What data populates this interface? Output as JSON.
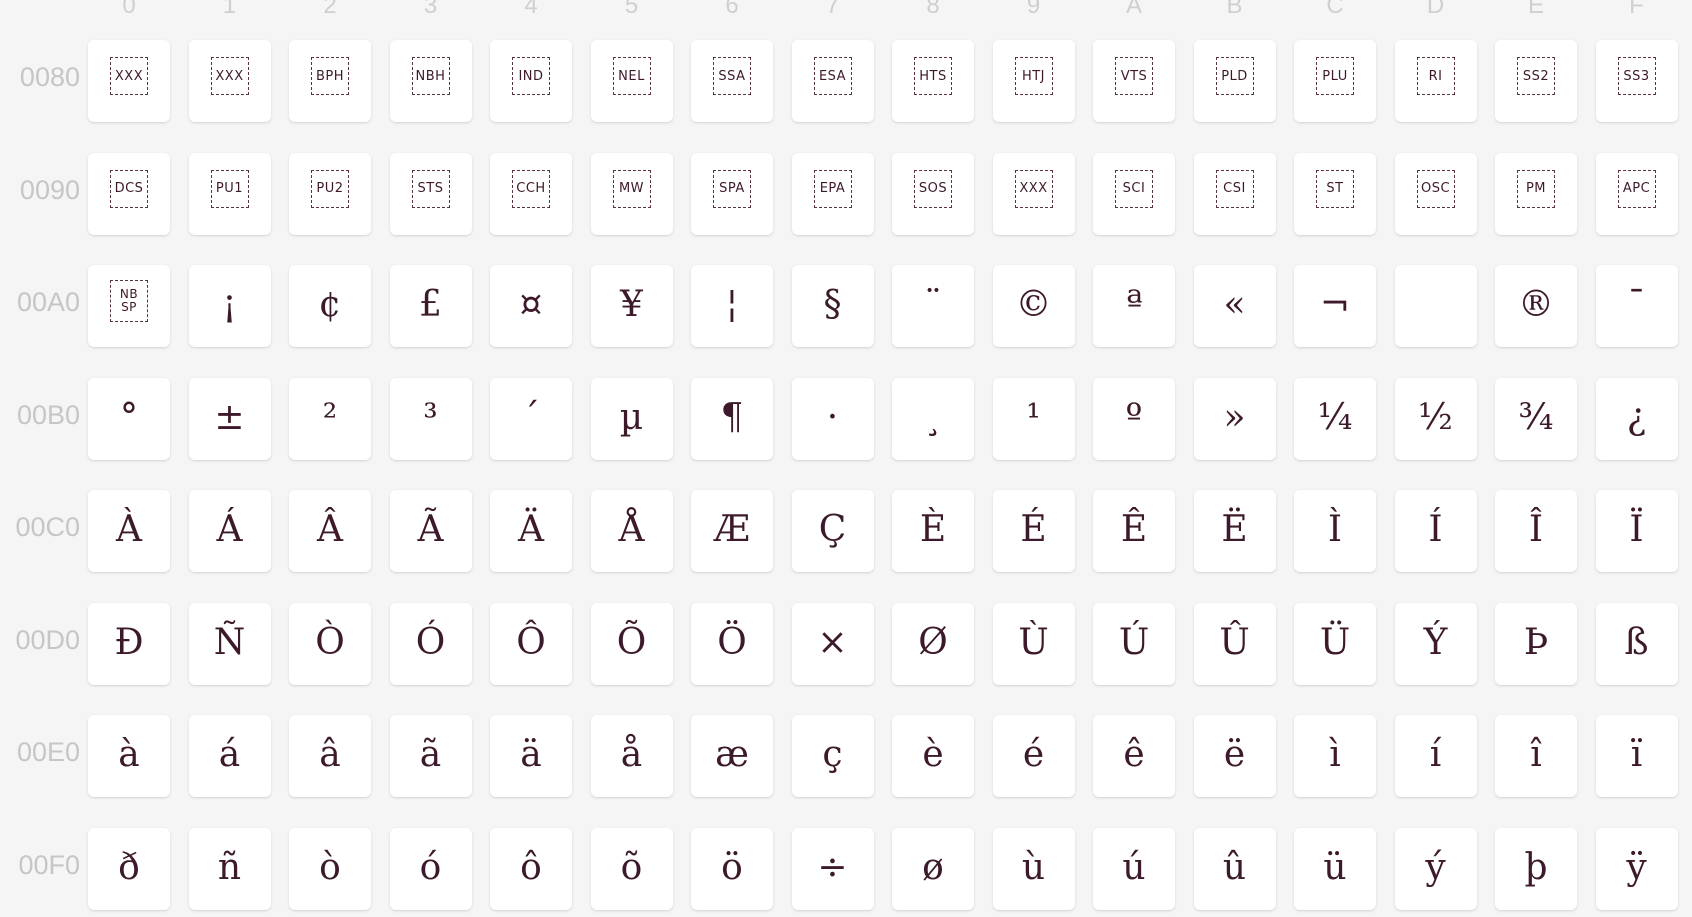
{
  "columns": [
    "0",
    "1",
    "2",
    "3",
    "4",
    "5",
    "6",
    "7",
    "8",
    "9",
    "A",
    "B",
    "C",
    "D",
    "E",
    "F"
  ],
  "rows": [
    {
      "label": "0080",
      "cells": [
        {
          "glyph": "XXX",
          "control": true,
          "name": "XXX"
        },
        {
          "glyph": "XXX",
          "control": true,
          "name": "XXX"
        },
        {
          "glyph": "BPH",
          "control": true,
          "name": "BPH"
        },
        {
          "glyph": "NBH",
          "control": true,
          "name": "NBH"
        },
        {
          "glyph": "IND",
          "control": true,
          "name": "IND"
        },
        {
          "glyph": "NEL",
          "control": true,
          "name": "NEL"
        },
        {
          "glyph": "SSA",
          "control": true,
          "name": "SSA"
        },
        {
          "glyph": "ESA",
          "control": true,
          "name": "ESA"
        },
        {
          "glyph": "HTS",
          "control": true,
          "name": "HTS"
        },
        {
          "glyph": "HTJ",
          "control": true,
          "name": "HTJ"
        },
        {
          "glyph": "VTS",
          "control": true,
          "name": "VTS"
        },
        {
          "glyph": "PLD",
          "control": true,
          "name": "PLD"
        },
        {
          "glyph": "PLU",
          "control": true,
          "name": "PLU"
        },
        {
          "glyph": "RI",
          "control": true,
          "name": "RI"
        },
        {
          "glyph": "SS2",
          "control": true,
          "name": "SS2"
        },
        {
          "glyph": "SS3",
          "control": true,
          "name": "SS3"
        }
      ]
    },
    {
      "label": "0090",
      "cells": [
        {
          "glyph": "DCS",
          "control": true,
          "name": "DCS"
        },
        {
          "glyph": "PU1",
          "control": true,
          "name": "PU1"
        },
        {
          "glyph": "PU2",
          "control": true,
          "name": "PU2"
        },
        {
          "glyph": "STS",
          "control": true,
          "name": "STS"
        },
        {
          "glyph": "CCH",
          "control": true,
          "name": "CCH"
        },
        {
          "glyph": "MW",
          "control": true,
          "name": "MW"
        },
        {
          "glyph": "SPA",
          "control": true,
          "name": "SPA"
        },
        {
          "glyph": "EPA",
          "control": true,
          "name": "EPA"
        },
        {
          "glyph": "SOS",
          "control": true,
          "name": "SOS"
        },
        {
          "glyph": "XXX",
          "control": true,
          "name": "XXX"
        },
        {
          "glyph": "SCI",
          "control": true,
          "name": "SCI"
        },
        {
          "glyph": "CSI",
          "control": true,
          "name": "CSI"
        },
        {
          "glyph": "ST",
          "control": true,
          "name": "ST"
        },
        {
          "glyph": "OSC",
          "control": true,
          "name": "OSC"
        },
        {
          "glyph": "PM",
          "control": true,
          "name": "PM"
        },
        {
          "glyph": "APC",
          "control": true,
          "name": "APC"
        }
      ]
    },
    {
      "label": "00A0",
      "cells": [
        {
          "glyph": "NB SP",
          "control": true,
          "two_line": true,
          "name": "NBSP"
        },
        {
          "glyph": "¡",
          "name": "inverted-exclamation"
        },
        {
          "glyph": "¢",
          "name": "cent"
        },
        {
          "glyph": "£",
          "name": "pound"
        },
        {
          "glyph": "¤",
          "name": "currency"
        },
        {
          "glyph": "¥",
          "name": "yen"
        },
        {
          "glyph": "¦",
          "name": "broken-bar"
        },
        {
          "glyph": "§",
          "name": "section"
        },
        {
          "glyph": "¨",
          "name": "diaeresis"
        },
        {
          "glyph": "©",
          "name": "copyright"
        },
        {
          "glyph": "ª",
          "name": "feminine-ordinal"
        },
        {
          "glyph": "«",
          "name": "left-guillemet"
        },
        {
          "glyph": "¬",
          "name": "not-sign"
        },
        {
          "glyph": "",
          "name": "soft-hyphen"
        },
        {
          "glyph": "®",
          "name": "registered"
        },
        {
          "glyph": "¯",
          "name": "macron"
        }
      ]
    },
    {
      "label": "00B0",
      "cells": [
        {
          "glyph": "°",
          "name": "degree"
        },
        {
          "glyph": "±",
          "name": "plus-minus"
        },
        {
          "glyph": "²",
          "name": "superscript-two"
        },
        {
          "glyph": "³",
          "name": "superscript-three"
        },
        {
          "glyph": "´",
          "name": "acute-accent"
        },
        {
          "glyph": "µ",
          "name": "micro"
        },
        {
          "glyph": "¶",
          "name": "pilcrow"
        },
        {
          "glyph": "·",
          "name": "middle-dot"
        },
        {
          "glyph": "¸",
          "name": "cedilla"
        },
        {
          "glyph": "¹",
          "name": "superscript-one"
        },
        {
          "glyph": "º",
          "name": "masculine-ordinal"
        },
        {
          "glyph": "»",
          "name": "right-guillemet"
        },
        {
          "glyph": "¼",
          "name": "one-quarter"
        },
        {
          "glyph": "½",
          "name": "one-half"
        },
        {
          "glyph": "¾",
          "name": "three-quarters"
        },
        {
          "glyph": "¿",
          "name": "inverted-question"
        }
      ]
    },
    {
      "label": "00C0",
      "cells": [
        {
          "glyph": "À",
          "name": "A-grave"
        },
        {
          "glyph": "Á",
          "name": "A-acute"
        },
        {
          "glyph": "Â",
          "name": "A-circumflex"
        },
        {
          "glyph": "Ã",
          "name": "A-tilde"
        },
        {
          "glyph": "Ä",
          "name": "A-diaeresis"
        },
        {
          "glyph": "Å",
          "name": "A-ring"
        },
        {
          "glyph": "Æ",
          "name": "AE"
        },
        {
          "glyph": "Ç",
          "name": "C-cedilla"
        },
        {
          "glyph": "È",
          "name": "E-grave"
        },
        {
          "glyph": "É",
          "name": "E-acute"
        },
        {
          "glyph": "Ê",
          "name": "E-circumflex"
        },
        {
          "glyph": "Ë",
          "name": "E-diaeresis"
        },
        {
          "glyph": "Ì",
          "name": "I-grave"
        },
        {
          "glyph": "Í",
          "name": "I-acute"
        },
        {
          "glyph": "Î",
          "name": "I-circumflex"
        },
        {
          "glyph": "Ï",
          "name": "I-diaeresis"
        }
      ]
    },
    {
      "label": "00D0",
      "cells": [
        {
          "glyph": "Ð",
          "name": "Eth"
        },
        {
          "glyph": "Ñ",
          "name": "N-tilde"
        },
        {
          "glyph": "Ò",
          "name": "O-grave"
        },
        {
          "glyph": "Ó",
          "name": "O-acute"
        },
        {
          "glyph": "Ô",
          "name": "O-circumflex"
        },
        {
          "glyph": "Õ",
          "name": "O-tilde"
        },
        {
          "glyph": "Ö",
          "name": "O-diaeresis"
        },
        {
          "glyph": "×",
          "name": "multiplication"
        },
        {
          "glyph": "Ø",
          "name": "O-stroke"
        },
        {
          "glyph": "Ù",
          "name": "U-grave"
        },
        {
          "glyph": "Ú",
          "name": "U-acute"
        },
        {
          "glyph": "Û",
          "name": "U-circumflex"
        },
        {
          "glyph": "Ü",
          "name": "U-diaeresis"
        },
        {
          "glyph": "Ý",
          "name": "Y-acute"
        },
        {
          "glyph": "Þ",
          "name": "Thorn"
        },
        {
          "glyph": "ß",
          "name": "sharp-s"
        }
      ]
    },
    {
      "label": "00E0",
      "cells": [
        {
          "glyph": "à",
          "name": "a-grave"
        },
        {
          "glyph": "á",
          "name": "a-acute"
        },
        {
          "glyph": "â",
          "name": "a-circumflex"
        },
        {
          "glyph": "ã",
          "name": "a-tilde"
        },
        {
          "glyph": "ä",
          "name": "a-diaeresis"
        },
        {
          "glyph": "å",
          "name": "a-ring"
        },
        {
          "glyph": "æ",
          "name": "ae"
        },
        {
          "glyph": "ç",
          "name": "c-cedilla"
        },
        {
          "glyph": "è",
          "name": "e-grave"
        },
        {
          "glyph": "é",
          "name": "e-acute"
        },
        {
          "glyph": "ê",
          "name": "e-circumflex"
        },
        {
          "glyph": "ë",
          "name": "e-diaeresis"
        },
        {
          "glyph": "ì",
          "name": "i-grave"
        },
        {
          "glyph": "í",
          "name": "i-acute"
        },
        {
          "glyph": "î",
          "name": "i-circumflex"
        },
        {
          "glyph": "ï",
          "name": "i-diaeresis"
        }
      ]
    },
    {
      "label": "00F0",
      "cells": [
        {
          "glyph": "ð",
          "name": "eth"
        },
        {
          "glyph": "ñ",
          "name": "n-tilde"
        },
        {
          "glyph": "ò",
          "name": "o-grave"
        },
        {
          "glyph": "ó",
          "name": "o-acute"
        },
        {
          "glyph": "ô",
          "name": "o-circumflex"
        },
        {
          "glyph": "õ",
          "name": "o-tilde"
        },
        {
          "glyph": "ö",
          "name": "o-diaeresis"
        },
        {
          "glyph": "÷",
          "name": "division"
        },
        {
          "glyph": "ø",
          "name": "o-stroke"
        },
        {
          "glyph": "ù",
          "name": "u-grave"
        },
        {
          "glyph": "ú",
          "name": "u-acute"
        },
        {
          "glyph": "û",
          "name": "u-circumflex"
        },
        {
          "glyph": "ü",
          "name": "u-diaeresis"
        },
        {
          "glyph": "ý",
          "name": "y-acute"
        },
        {
          "glyph": "þ",
          "name": "thorn"
        },
        {
          "glyph": "ÿ",
          "name": "y-diaeresis"
        }
      ]
    }
  ],
  "colors": {
    "background": "#f5f5f5",
    "cell": "#ffffff",
    "glyph": "#3d1a2b",
    "label": "#c6c6c6"
  }
}
